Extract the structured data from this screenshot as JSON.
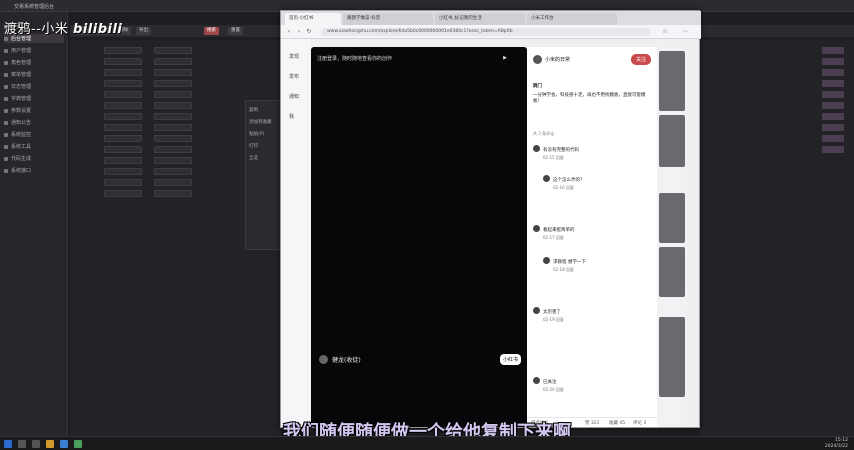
{
  "watermark": {
    "text": "渡鸦--小米",
    "brand": "bilibili"
  },
  "subtitle": "我们随便随便做一个给他复制下来啊",
  "bg_app": {
    "title": "交易系统管理后台",
    "sidebar": [
      {
        "label": "首页"
      },
      {
        "label": "后台管理"
      },
      {
        "label": "用户管理"
      },
      {
        "label": "角色管理"
      },
      {
        "label": "菜单管理"
      },
      {
        "label": "日志管理"
      },
      {
        "label": "字典管理"
      },
      {
        "label": "参数设置"
      },
      {
        "label": "通知公告"
      },
      {
        "label": "系统监控"
      },
      {
        "label": "系统工具"
      },
      {
        "label": "代码生成"
      },
      {
        "label": "系统接口"
      }
    ],
    "toolbar": [
      "新增",
      "修改",
      "删除",
      "导出",
      "搜索",
      "重置"
    ],
    "mid_lines": [
      "复制",
      "添加到收藏",
      "粘贴(P)",
      "打印",
      "全选"
    ]
  },
  "browser": {
    "tabs": [
      "首页-小红书",
      "跟我学做菜-抖音",
      "小红书_标记我的生活",
      "小米工作台"
    ],
    "url": "www.xiaohongshu.com/explore/64a5b0c0000000001e0384c1?xsec_token=ABpXb",
    "left_nav": [
      "发现",
      "发布",
      "通知",
      "我"
    ],
    "player": {
      "title": "注册登录，随时随地查看你的创作",
      "author": "健龙(收徒)",
      "follow": "小红书"
    },
    "comments": {
      "user": "小米的日常",
      "follow_btn": "关注",
      "intro_title": "跳门",
      "intro": "一分钟学会，科技感十足，再也不用找模板，直接可套模板！",
      "count": "共 3 条评论",
      "items": [
        {
          "text": "有没有完整的代码",
          "meta": "02-15 回复"
        },
        {
          "text": "这个怎么弄的？",
          "meta": "02-16 回复"
        },
        {
          "text": "看起来挺简单的",
          "meta": "02-17 回复"
        },
        {
          "text": "求教程 想学一下",
          "meta": "02-18 回复"
        },
        {
          "text": "太厉害了",
          "meta": "02-19 回复"
        },
        {
          "text": "已关注",
          "meta": "02-20 回复"
        }
      ],
      "bottom": [
        "说点什么...",
        "赞 321",
        "收藏 45",
        "评论 3"
      ]
    }
  },
  "taskbar": {
    "time": "15:12",
    "date": "2024/3/22"
  }
}
